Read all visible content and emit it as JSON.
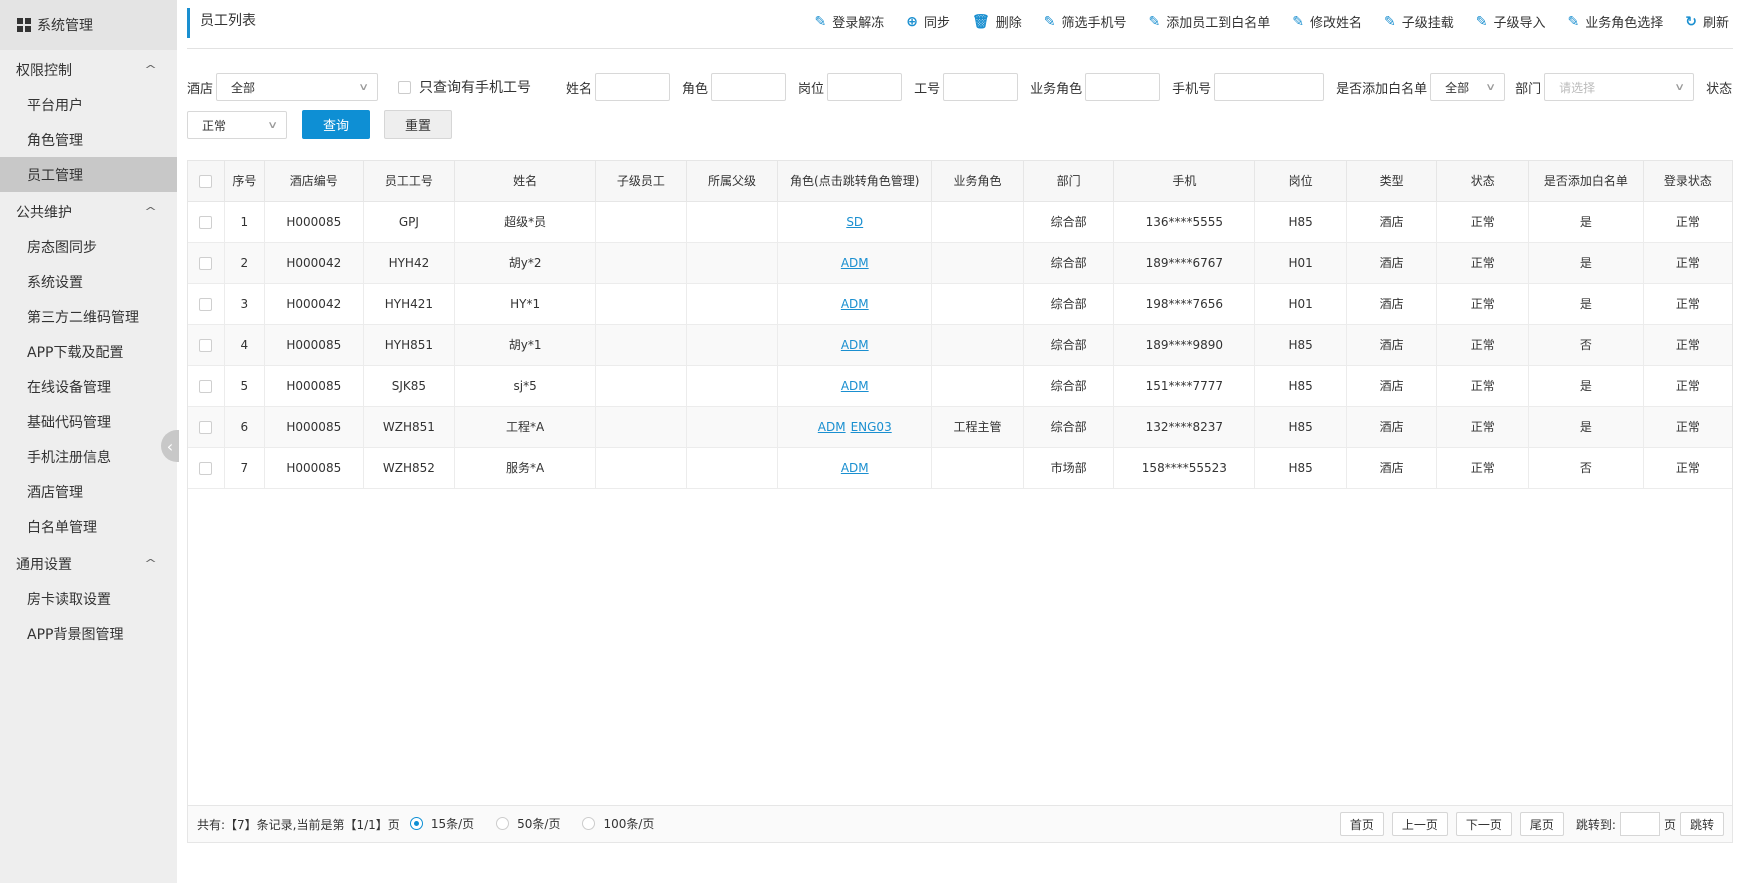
{
  "sidebar": {
    "title": "系统管理",
    "groups": [
      {
        "label": "权限控制",
        "items": [
          "平台用户",
          "角色管理",
          "员工管理"
        ]
      },
      {
        "label": "公共维护",
        "items": [
          "房态图同步",
          "系统设置",
          "第三方二维码管理",
          "APP下载及配置",
          "在线设备管理",
          "基础代码管理",
          "手机注册信息",
          "酒店管理",
          "白名单管理"
        ]
      },
      {
        "label": "通用设置",
        "items": [
          "房卡读取设置",
          "APP背景图管理"
        ]
      }
    ],
    "active_item": "员工管理"
  },
  "page_title": "员工列表",
  "toolbar": [
    {
      "label": "登录解冻",
      "icon": "pencil-icon"
    },
    {
      "label": "同步",
      "icon": "plus-circle-icon"
    },
    {
      "label": "删除",
      "icon": "trash-icon"
    },
    {
      "label": "筛选手机号",
      "icon": "pencil-icon"
    },
    {
      "label": "添加员工到白名单",
      "icon": "pencil-icon"
    },
    {
      "label": "修改姓名",
      "icon": "pencil-icon"
    },
    {
      "label": "子级挂载",
      "icon": "pencil-icon"
    },
    {
      "label": "子级导入",
      "icon": "pencil-icon"
    },
    {
      "label": "业务角色选择",
      "icon": "pencil-icon"
    },
    {
      "label": "刷新",
      "icon": "refresh-icon"
    }
  ],
  "filters": {
    "hotel_label": "酒店",
    "hotel_value": "全部",
    "phone_only_label": "只查询有手机工号",
    "name_label": "姓名",
    "role_label": "角色",
    "post_label": "岗位",
    "job_no_label": "工号",
    "biz_role_label": "业务角色",
    "phone_label": "手机号",
    "whitelist_label": "是否添加白名单",
    "whitelist_value": "全部",
    "dept_label": "部门",
    "dept_placeholder": "请选择",
    "status_label": "状态",
    "status_value": "正常",
    "query_button": "查询",
    "reset_button": "重置"
  },
  "table": {
    "headers": [
      "序号",
      "酒店编号",
      "员工工号",
      "姓名",
      "子级员工",
      "所属父级",
      "角色(点击跳转角色管理)",
      "业务角色",
      "部门",
      "手机",
      "岗位",
      "类型",
      "状态",
      "是否添加白名单",
      "登录状态"
    ],
    "rows": [
      {
        "no": "1",
        "hotel": "H000085",
        "emp_no": "GPJ",
        "name": "超级*员",
        "child": "",
        "parent": "",
        "roles": [
          "SD"
        ],
        "biz_role": "",
        "dept": "综合部",
        "phone": "136****5555",
        "post": "H85",
        "type": "酒店",
        "status": "正常",
        "whitelist": "是",
        "login": "正常"
      },
      {
        "no": "2",
        "hotel": "H000042",
        "emp_no": "HYH42",
        "name": "胡y*2",
        "child": "",
        "parent": "",
        "roles": [
          "ADM"
        ],
        "biz_role": "",
        "dept": "综合部",
        "phone": "189****6767",
        "post": "H01",
        "type": "酒店",
        "status": "正常",
        "whitelist": "是",
        "login": "正常"
      },
      {
        "no": "3",
        "hotel": "H000042",
        "emp_no": "HYH421",
        "name": "HY*1",
        "child": "",
        "parent": "",
        "roles": [
          "ADM"
        ],
        "biz_role": "",
        "dept": "综合部",
        "phone": "198****7656",
        "post": "H01",
        "type": "酒店",
        "status": "正常",
        "whitelist": "是",
        "login": "正常"
      },
      {
        "no": "4",
        "hotel": "H000085",
        "emp_no": "HYH851",
        "name": "胡y*1",
        "child": "",
        "parent": "",
        "roles": [
          "ADM"
        ],
        "biz_role": "",
        "dept": "综合部",
        "phone": "189****9890",
        "post": "H85",
        "type": "酒店",
        "status": "正常",
        "whitelist": "否",
        "login": "正常"
      },
      {
        "no": "5",
        "hotel": "H000085",
        "emp_no": "SJK85",
        "name": "sj*5",
        "child": "",
        "parent": "",
        "roles": [
          "ADM"
        ],
        "biz_role": "",
        "dept": "综合部",
        "phone": "151****7777",
        "post": "H85",
        "type": "酒店",
        "status": "正常",
        "whitelist": "是",
        "login": "正常"
      },
      {
        "no": "6",
        "hotel": "H000085",
        "emp_no": "WZH851",
        "name": "工程*A",
        "child": "",
        "parent": "",
        "roles": [
          "ADM",
          "ENG03"
        ],
        "biz_role": "工程主管",
        "dept": "综合部",
        "phone": "132****8237",
        "post": "H85",
        "type": "酒店",
        "status": "正常",
        "whitelist": "是",
        "login": "正常"
      },
      {
        "no": "7",
        "hotel": "H000085",
        "emp_no": "WZH852",
        "name": "服务*A",
        "child": "",
        "parent": "",
        "roles": [
          "ADM"
        ],
        "biz_role": "",
        "dept": "市场部",
        "phone": "158****55523",
        "post": "H85",
        "type": "酒店",
        "status": "正常",
        "whitelist": "否",
        "login": "正常"
      }
    ]
  },
  "pager": {
    "summary": "共有:【7】条记录,当前是第【1/1】页",
    "page_sizes": [
      "15条/页",
      "50条/页",
      "100条/页"
    ],
    "selected_size": "15条/页",
    "first": "首页",
    "prev": "上一页",
    "next": "下一页",
    "last": "尾页",
    "jump_label": "跳转到:",
    "page_unit": "页",
    "jump_button": "跳转"
  },
  "colors": {
    "accent": "#0e8fd4",
    "link": "#1a8fd0",
    "sidebar_bg": "#eeeeee",
    "active_bg": "#c8c8c8"
  }
}
